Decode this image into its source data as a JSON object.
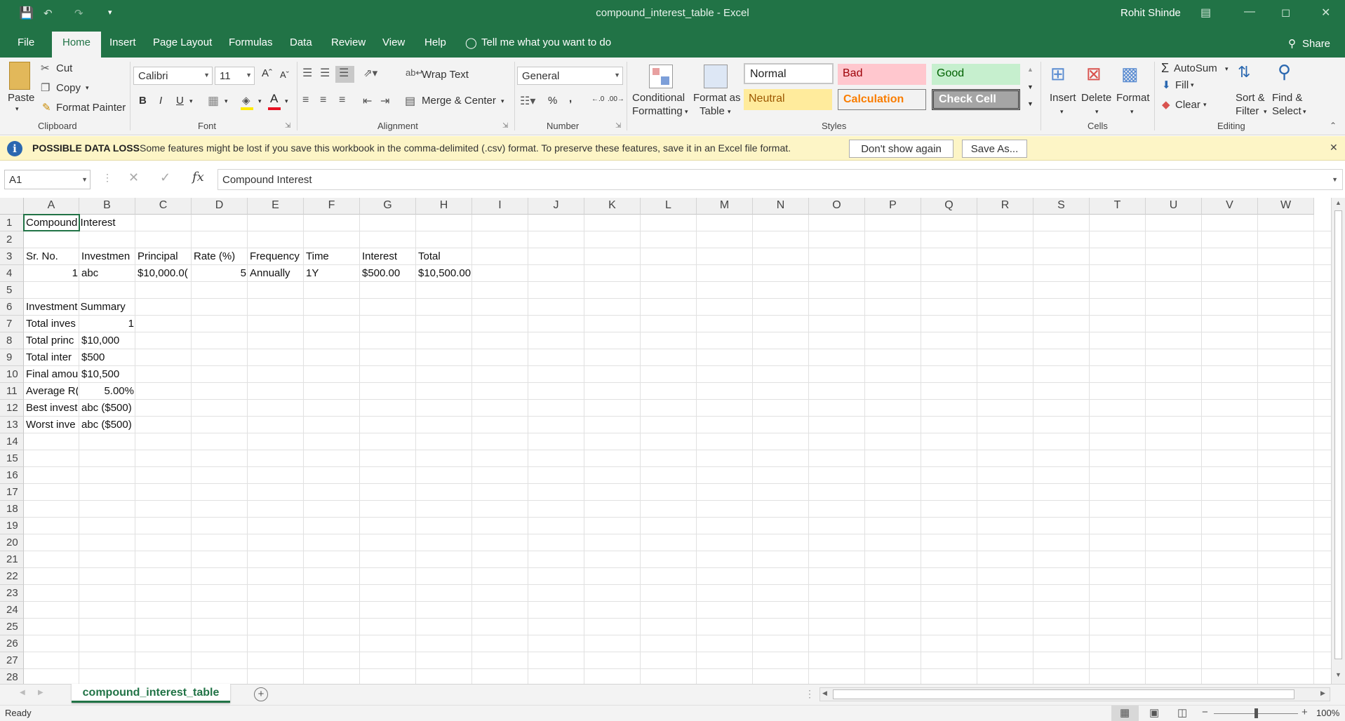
{
  "window": {
    "title": "compound_interest_table  -  Excel",
    "user": "Rohit Shinde"
  },
  "tabs": [
    "File",
    "Home",
    "Insert",
    "Page Layout",
    "Formulas",
    "Data",
    "Review",
    "View",
    "Help"
  ],
  "tell_me": "Tell me what you want to do",
  "share": "Share",
  "clipboard": {
    "paste": "Paste",
    "cut": "Cut",
    "copy": "Copy",
    "format_painter": "Format Painter",
    "label": "Clipboard"
  },
  "font": {
    "name": "Calibri",
    "size": "11",
    "label": "Font",
    "bold": "B",
    "italic": "I",
    "underline": "U"
  },
  "alignment": {
    "wrap": "Wrap Text",
    "merge": "Merge & Center",
    "label": "Alignment"
  },
  "number": {
    "format": "General",
    "label": "Number"
  },
  "styles": {
    "cond1": "Conditional",
    "cond2": "Formatting",
    "fmt1": "Format as",
    "fmt2": "Table",
    "normal": "Normal",
    "bad": "Bad",
    "good": "Good",
    "neutral": "Neutral",
    "calculation": "Calculation",
    "check": "Check Cell",
    "label": "Styles"
  },
  "cells": {
    "insert": "Insert",
    "delete": "Delete",
    "format": "Format",
    "label": "Cells"
  },
  "editing": {
    "autosum": "AutoSum",
    "fill": "Fill",
    "clear": "Clear",
    "sort1": "Sort &",
    "sort2": "Filter",
    "find1": "Find &",
    "find2": "Select",
    "label": "Editing"
  },
  "banner": {
    "title": "POSSIBLE DATA LOSS",
    "message": "Some features might be lost if you save this workbook in the comma-delimited (.csv) format. To preserve these features, save it in an Excel file format.",
    "dont_show": "Don't show again",
    "save_as": "Save As..."
  },
  "formula_bar": {
    "name_box": "A1",
    "formula": "Compound Interest"
  },
  "columns": [
    "A",
    "B",
    "C",
    "D",
    "E",
    "F",
    "G",
    "H",
    "I",
    "J",
    "K",
    "L",
    "M",
    "N",
    "O",
    "P",
    "Q",
    "R",
    "S",
    "T",
    "U",
    "V",
    "W"
  ],
  "rows": [
    "1",
    "2",
    "3",
    "4",
    "5",
    "6",
    "7",
    "8",
    "9",
    "10",
    "11",
    "12",
    "13",
    "14",
    "15",
    "16",
    "17",
    "18",
    "19",
    "20",
    "21",
    "22",
    "23",
    "24",
    "25",
    "26",
    "27",
    "28"
  ],
  "cells_data": {
    "A1": "Compound Interest",
    "A3": "Sr. No.",
    "B3": "Investmen",
    "C3": "Principal",
    "D3": "Rate (%)",
    "E3": "Frequency",
    "F3": "Time",
    "G3": "Interest",
    "H3": "Total",
    "A4": "1",
    "B4": "abc",
    "C4": "$10,000.0(",
    "D4": "5",
    "E4": "Annually",
    "F4": "1Y",
    "G4": "$500.00",
    "H4": "$10,500.00",
    "A6": "Investment Summary",
    "A7": "Total inves",
    "B7": "1",
    "A8": "Total princ",
    "B8": "$10,000",
    "A9": "Total inter",
    "B9": "$500",
    "A10": "Final amou",
    "B10": "$10,500",
    "A11": "Average R(",
    "B11": "5.00%",
    "A12": "Best invest",
    "B12": "abc ($500)",
    "A13": "Worst inve",
    "B13": "abc ($500)"
  },
  "sheet_tab": "compound_interest_table",
  "status": {
    "ready": "Ready",
    "zoom": "100%"
  }
}
